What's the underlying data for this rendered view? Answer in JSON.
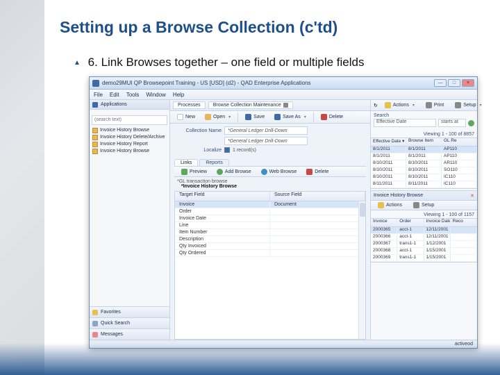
{
  "slide": {
    "title": "Setting up a Browse Collection (c'td)",
    "bullet_number": "6.",
    "bullet_text": "Link Browses together – one field or multiple fields"
  },
  "window": {
    "title": "demo29MUI QP Browsepoint Training - US [USD] (d2) - QAD Enterprise Applications",
    "minimize": "—",
    "maximize": "□",
    "close": "×"
  },
  "menu": {
    "items": [
      "File",
      "Edit",
      "Tools",
      "Window",
      "Help"
    ]
  },
  "nav": {
    "header": "Applications",
    "search_placeholder": "(search text)",
    "tree": [
      "Invoice History Browse",
      "Invoice History Delete/Archive",
      "Invoice History Report",
      "Invoice History Browse"
    ],
    "tabs": [
      {
        "label": "Favorites",
        "color": "#e6c24d"
      },
      {
        "label": "Quick Search",
        "color": "#8aa6c6"
      },
      {
        "label": "Messages",
        "color": "#e68989"
      }
    ]
  },
  "doctabs": [
    {
      "label": "Processes"
    },
    {
      "label": "Browse Collection Maintenance",
      "closable": true
    }
  ],
  "toolbar": {
    "new": "New",
    "open": "Open",
    "save": "Save",
    "saveas": "Save As",
    "delete": "Delete"
  },
  "form": {
    "name_label": "Collection Name",
    "name_value": "*General Ledger Drill-Down",
    "desc_value": "*General Ledger Drill-Down",
    "local_label": "Localize",
    "local_checked": true,
    "local_text": "1 record(s)"
  },
  "subtabs": {
    "links": "Links",
    "reports": "Reports"
  },
  "linktoolbar": {
    "preview": "Preview",
    "add": "Add Browse",
    "web": "Web Browse",
    "del": "Delete"
  },
  "linkheader": {
    "prefix": "*GL transaction browse",
    "name": "*Invoice History Browse"
  },
  "fieldgrid": {
    "headers": [
      "Target Field",
      "Source Field"
    ],
    "rows": [
      [
        "Invoice",
        "Document"
      ],
      [
        "Order",
        ""
      ],
      [
        "Invoice Date",
        ""
      ],
      [
        "Line",
        ""
      ],
      [
        "Item Number",
        ""
      ],
      [
        "Description",
        ""
      ],
      [
        "Qty Invoiced",
        ""
      ],
      [
        "Qty Ordered",
        ""
      ]
    ],
    "selected": 0
  },
  "right": {
    "refresh": "↻",
    "actions": "Actions",
    "print": "Print",
    "setup": "Setup",
    "search_label": "Search",
    "filter_field": "Effective Date",
    "filter_op": "starts at",
    "viewing1": "Viewing 1 - 100 of 8857",
    "grid1": {
      "headers": [
        "Effective Date ▾",
        "Browse Item",
        "GL Re"
      ],
      "rows": [
        [
          "8/1/2011",
          "8/1/2011",
          "AP110"
        ],
        [
          "8/1/2011",
          "8/1/2011",
          "AP110"
        ],
        [
          "8/10/2011",
          "8/10/2011",
          "AR110"
        ],
        [
          "8/10/2011",
          "8/10/2011",
          "SO110"
        ],
        [
          "8/10/2011",
          "8/10/2011",
          "IC110"
        ],
        [
          "8/11/2011",
          "8/11/2011",
          "IC110"
        ]
      ],
      "selected": 0
    },
    "sub_title": "Invoice History Browse",
    "viewing2": "Viewing 1 - 100 of 1157",
    "grid2": {
      "headers": [
        "Invoice",
        "Order",
        "Invoice Date",
        "Reco"
      ],
      "rows": [
        [
          "2000365",
          "acct-1",
          "12/11/2001",
          ""
        ],
        [
          "2000366",
          "acct-1",
          "12/11/2001",
          ""
        ],
        [
          "2000367",
          "trans1-1",
          "1/12/2001",
          ""
        ],
        [
          "2000368",
          "acct-1",
          "1/15/2001",
          ""
        ],
        [
          "2000369",
          "trans1-1",
          "1/15/2001",
          ""
        ]
      ],
      "selected": 0
    }
  },
  "status": {
    "text": "activeod"
  }
}
